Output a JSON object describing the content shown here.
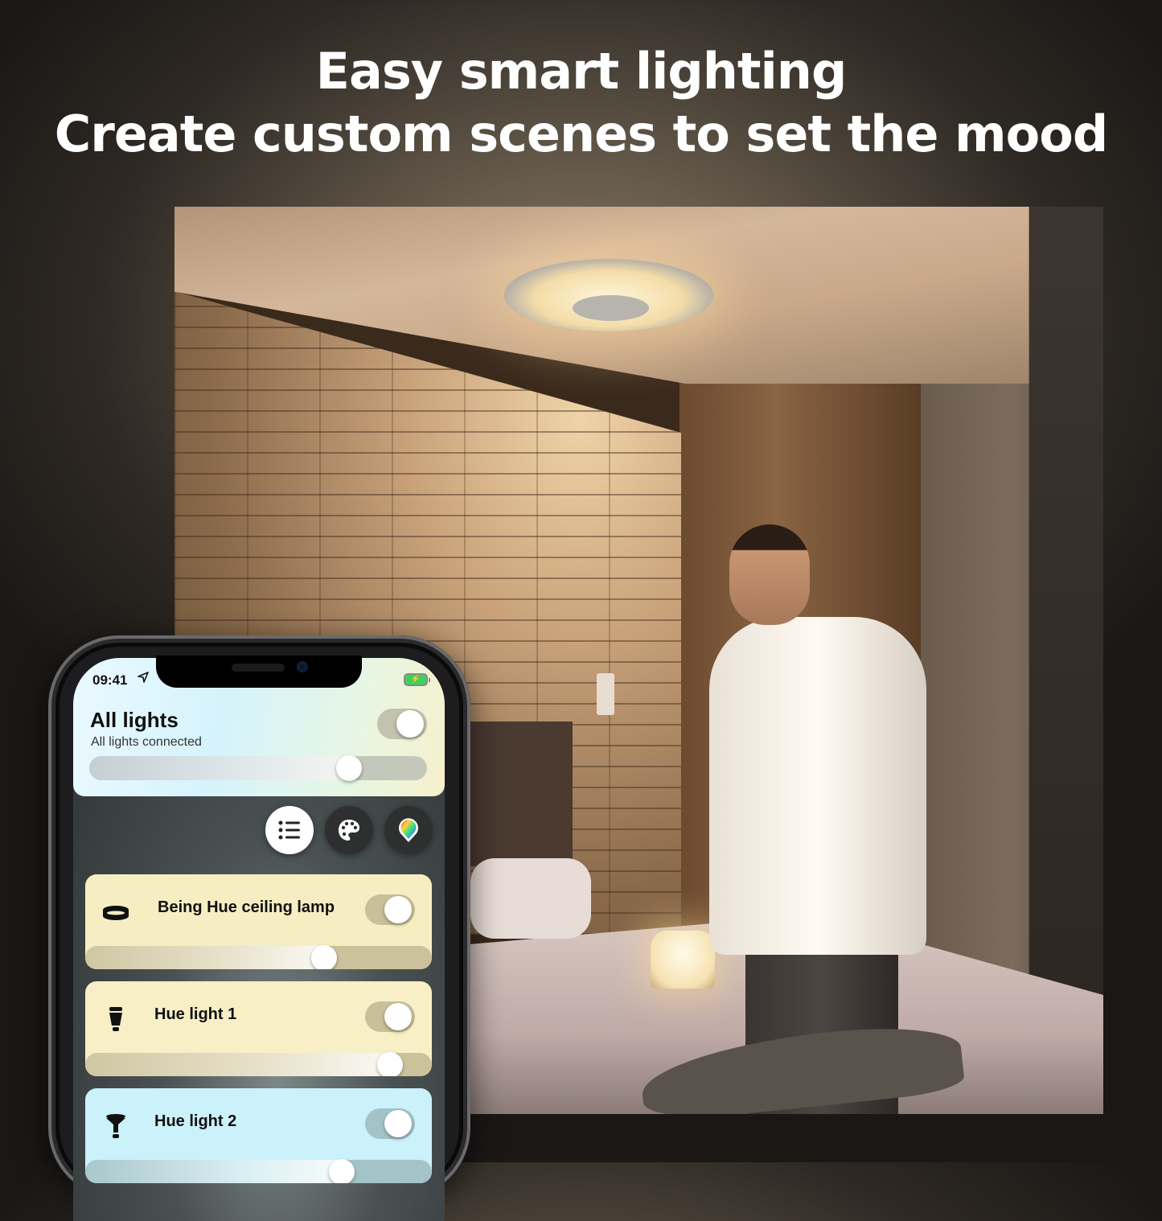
{
  "headline": {
    "line1": "Easy smart lighting",
    "line2": "Create custom scenes to set the mood"
  },
  "photo": {
    "description": "bedroom with Being Hue ceiling lamp, man buttoning shirt cuff"
  },
  "phone": {
    "status_bar": {
      "time": "09:41",
      "location_icon": "location-arrow-icon",
      "battery_icon": "battery-charging-icon",
      "battery_color": "#3bd259"
    },
    "all_lights": {
      "title": "All lights",
      "subtitle": "All lights connected",
      "toggle_on": true,
      "brightness": 0.77
    },
    "view_buttons": [
      {
        "name": "list-view",
        "icon": "list-icon",
        "active": true
      },
      {
        "name": "scenes-view",
        "icon": "palette-icon",
        "active": false
      },
      {
        "name": "color-view",
        "icon": "color-picker-icon",
        "active": false
      }
    ],
    "lights": [
      {
        "name": "Being Hue ceiling lamp",
        "icon": "ceiling-lamp-icon",
        "on": true,
        "brightness": 0.69,
        "color": "#f7edc2"
      },
      {
        "name": "Hue light 1",
        "icon": "bulb-icon",
        "on": true,
        "brightness": 0.88,
        "color": "#f8efc6"
      },
      {
        "name": "Hue light 2",
        "icon": "spot-bulb-icon",
        "on": true,
        "brightness": 0.74,
        "color": "#cbf1fa"
      }
    ]
  }
}
